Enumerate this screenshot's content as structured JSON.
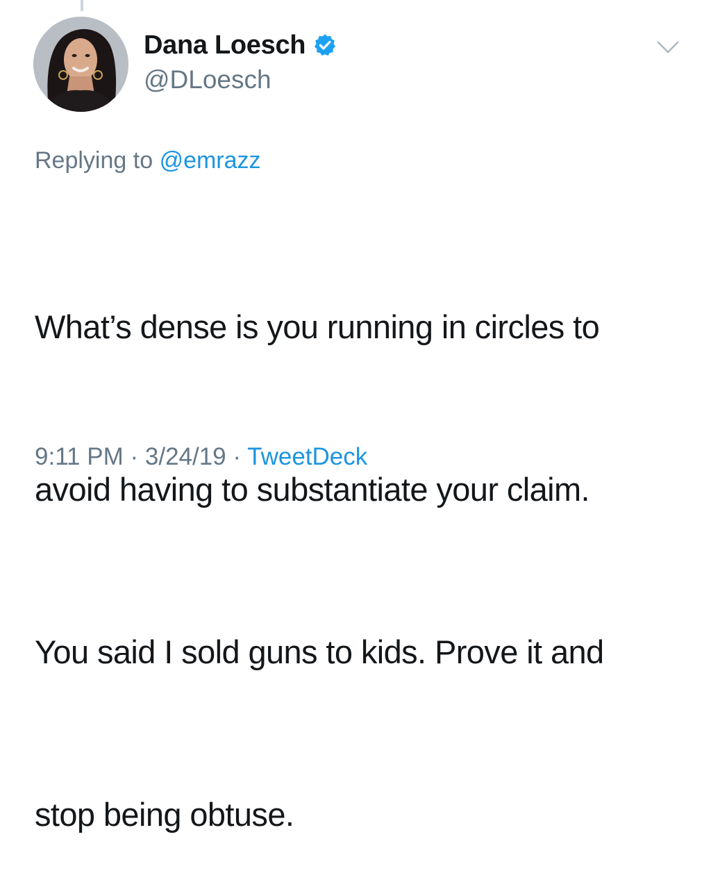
{
  "tweet": {
    "display_name": "Dana Loesch",
    "handle": "@DLoesch",
    "verified": true,
    "replying_to_label": "Replying to",
    "replying_to_handle": "@emrazz",
    "text_lines": [
      "What’s dense is you running in circles to",
      "avoid having to substantiate your claim.",
      "You said I sold guns to kids. Prove it and",
      "stop being obtuse."
    ],
    "time": "9:11 PM",
    "date": "3/24/19",
    "separator": "·",
    "source": "TweetDeck"
  },
  "icons": {
    "verified": "verified-badge-icon",
    "menu": "chevron-down-icon"
  },
  "colors": {
    "text": "#14171a",
    "secondary": "#657786",
    "link": "#1b95e0",
    "verified": "#1da1f2",
    "thread_line": "#ccd6dd"
  }
}
